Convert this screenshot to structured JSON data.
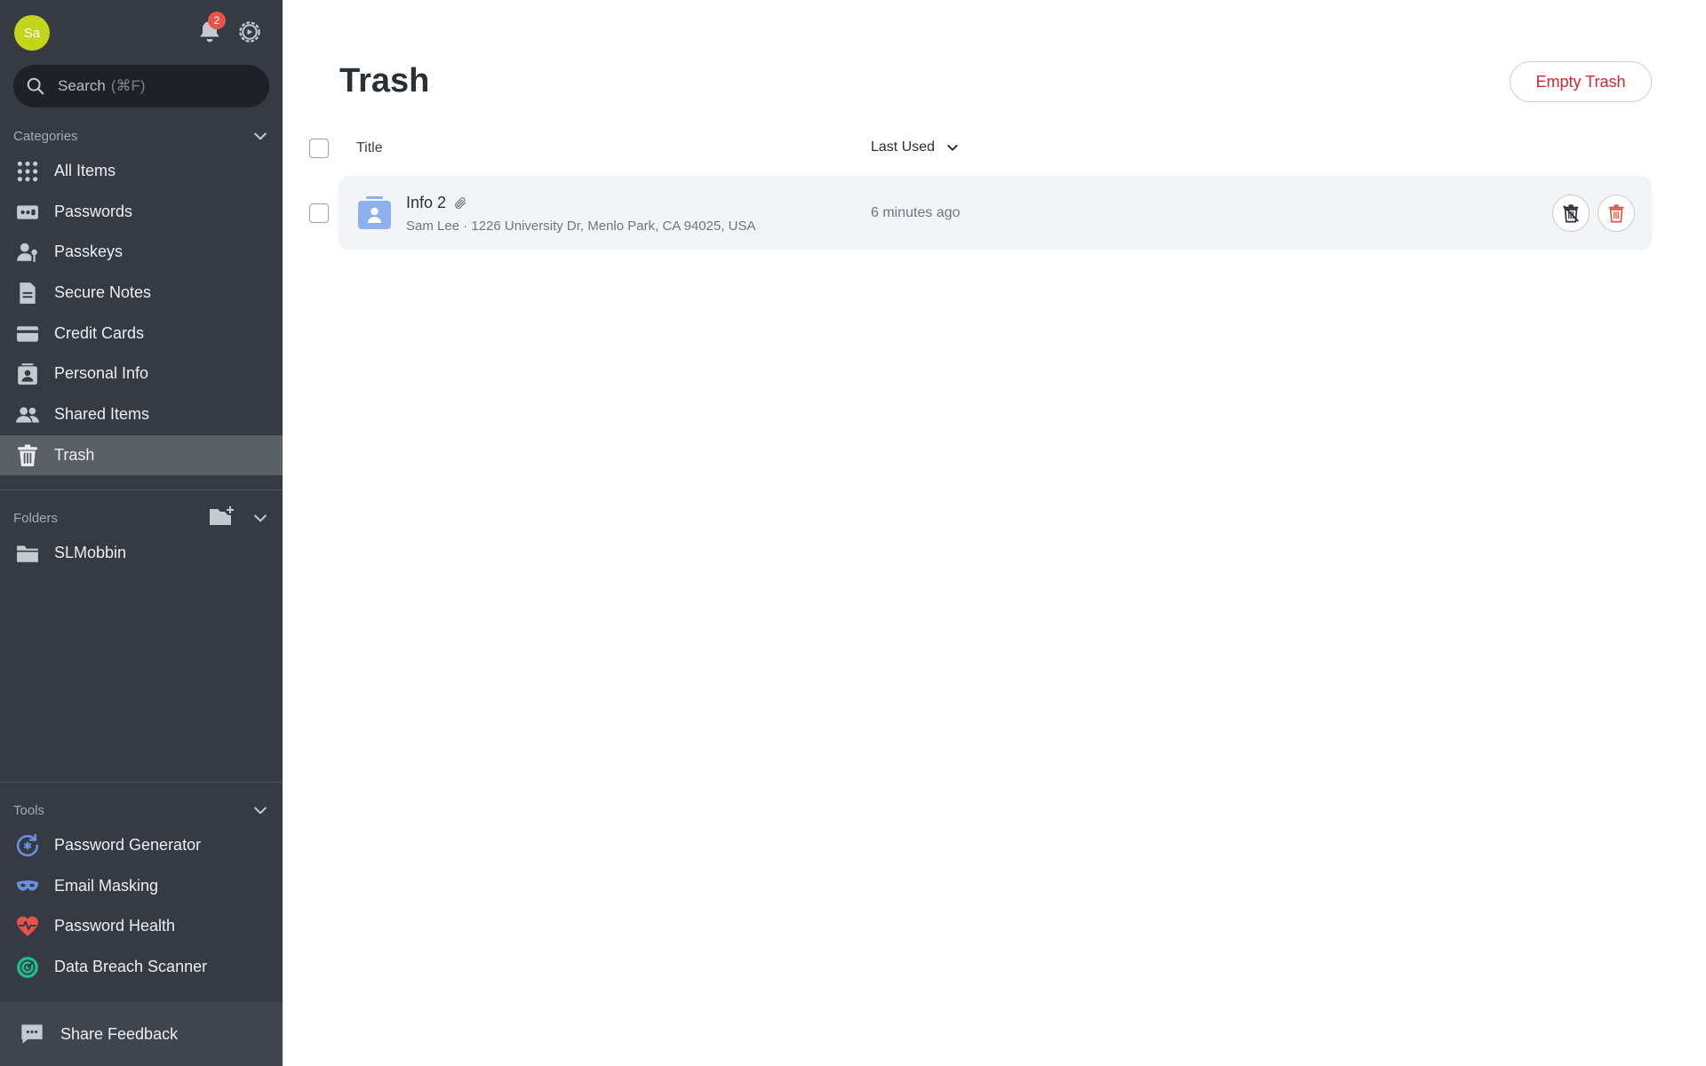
{
  "user": {
    "initials": "Sa",
    "notification_count": "2"
  },
  "search": {
    "label": "Search",
    "hint": "(⌘F)"
  },
  "categories": {
    "heading": "Categories",
    "items": [
      {
        "label": "All Items",
        "icon": "grid-icon"
      },
      {
        "label": "Passwords",
        "icon": "password-icon"
      },
      {
        "label": "Passkeys",
        "icon": "passkey-icon"
      },
      {
        "label": "Secure Notes",
        "icon": "note-icon"
      },
      {
        "label": "Credit Cards",
        "icon": "credit-card-icon"
      },
      {
        "label": "Personal Info",
        "icon": "personal-info-icon"
      },
      {
        "label": "Shared Items",
        "icon": "shared-users-icon"
      },
      {
        "label": "Trash",
        "icon": "trash-icon",
        "active": true
      }
    ]
  },
  "folders": {
    "heading": "Folders",
    "items": [
      {
        "label": "SLMobbin",
        "icon": "folder-icon"
      }
    ]
  },
  "tools": {
    "heading": "Tools",
    "items": [
      {
        "label": "Password Generator",
        "icon": "password-generator-icon",
        "color": "#6b8fe0"
      },
      {
        "label": "Email Masking",
        "icon": "mask-icon",
        "color": "#6b8fe0"
      },
      {
        "label": "Password Health",
        "icon": "heart-pulse-icon",
        "color": "#e5534b"
      },
      {
        "label": "Data Breach Scanner",
        "icon": "radar-icon",
        "color": "#1dbf8f"
      }
    ]
  },
  "feedback": {
    "label": "Share Feedback"
  },
  "main": {
    "title": "Trash",
    "empty_button": "Empty Trash",
    "columns": {
      "title": "Title",
      "sort": "Last Used"
    },
    "rows": [
      {
        "title": "Info 2",
        "subtitle": "Sam Lee · 1226 University Dr, Menlo Park, CA 94025, USA",
        "last_used": "6 minutes ago"
      }
    ]
  },
  "colors": {
    "sidebar": "#363a42",
    "active": "#5b5f66",
    "danger": "#d6262f",
    "accent": "#6b8fe0"
  }
}
